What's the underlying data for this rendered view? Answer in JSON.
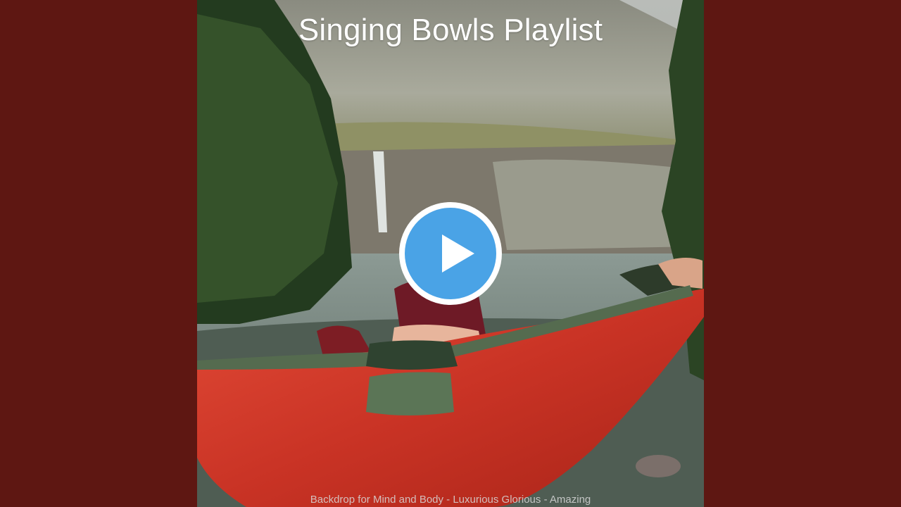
{
  "video": {
    "title": "Singing Bowls Playlist",
    "caption": "Backdrop for Mind and Body - Luxurious Glorious - Amazing"
  },
  "controls": {
    "play_icon": "play-icon"
  },
  "colors": {
    "background": "#5e1712",
    "play_button": "#4aa3e6",
    "hammock": "#d63a2c"
  }
}
